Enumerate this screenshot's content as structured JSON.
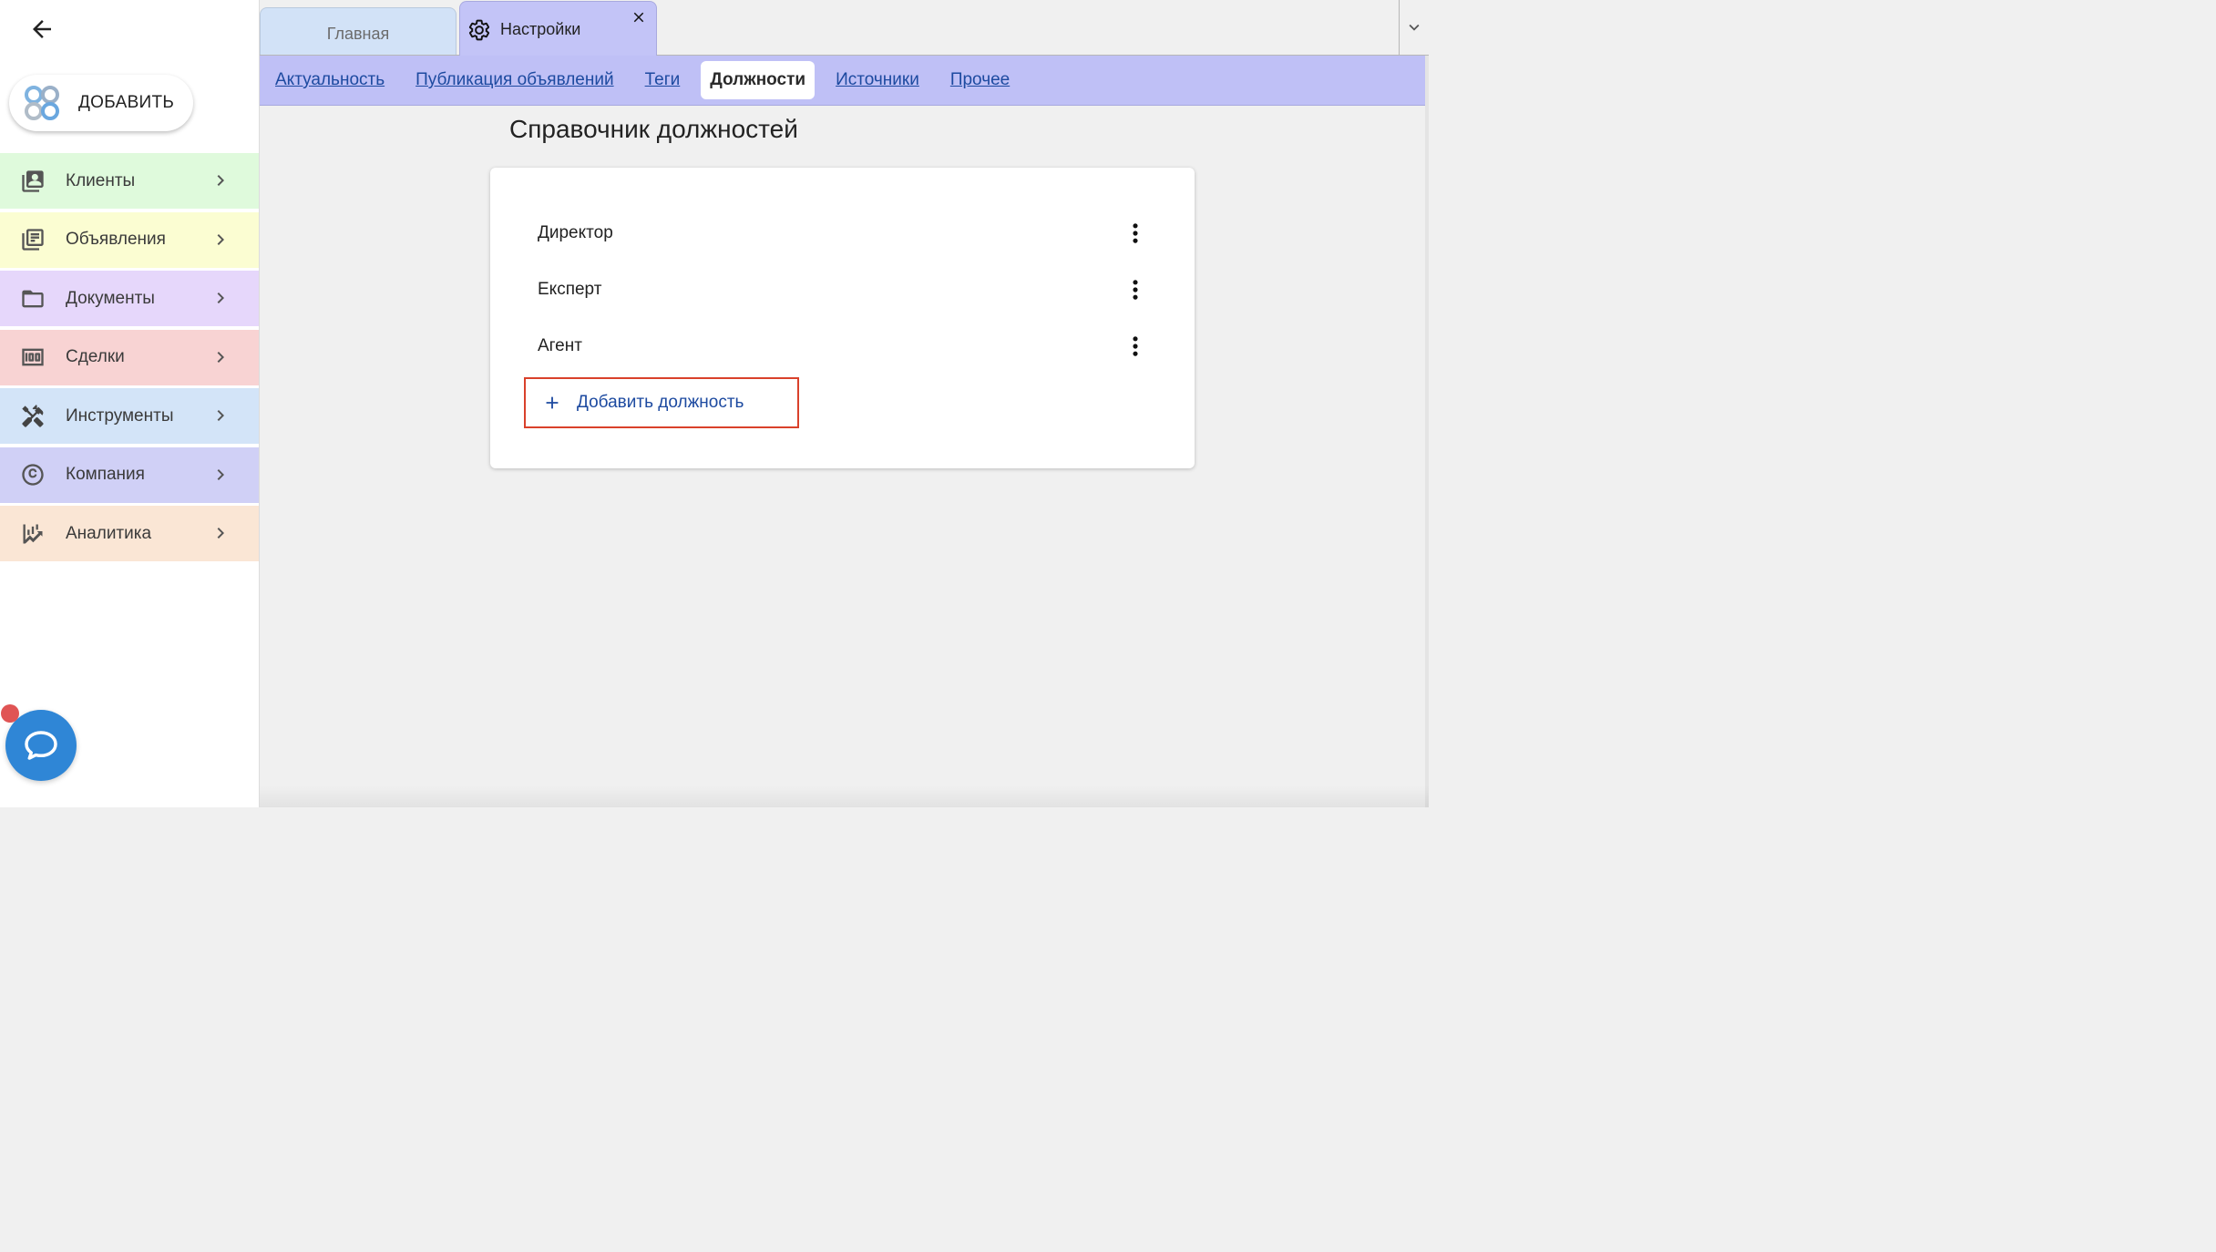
{
  "sidebar": {
    "add_button_label": "ДОБАВИТЬ",
    "items": [
      {
        "label": "Клиенты",
        "icon": "contacts-icon",
        "color": "#dffadc"
      },
      {
        "label": "Объявления",
        "icon": "listings-icon",
        "color": "#fbfdd2"
      },
      {
        "label": "Документы",
        "icon": "folder-icon",
        "color": "#e6d7fb"
      },
      {
        "label": "Сделки",
        "icon": "money-icon",
        "color": "#f8d3d3"
      },
      {
        "label": "Инструменты",
        "icon": "tools-icon",
        "color": "#d3e4f8"
      },
      {
        "label": "Компания",
        "icon": "copyright-icon",
        "color": "#d0d0f6"
      },
      {
        "label": "Аналитика",
        "icon": "analytics-icon",
        "color": "#fae6d5"
      }
    ]
  },
  "tabs": {
    "home_label": "Главная",
    "settings_label": "Настройки"
  },
  "subnav": {
    "links": [
      "Актуальность",
      "Публикация объявлений",
      "Теги",
      "Должности",
      "Источники",
      "Прочее"
    ],
    "active_index": 3
  },
  "main": {
    "title": "Справочник должностей",
    "positions": [
      "Директор",
      "Експерт",
      "Агент"
    ],
    "add_position_label": "Добавить должность"
  },
  "colors": {
    "accent_link": "#1d4aa0",
    "highlight_border": "#d9412b",
    "subnav_bg": "#bfc0f6",
    "chat_button": "#2f86d6"
  }
}
